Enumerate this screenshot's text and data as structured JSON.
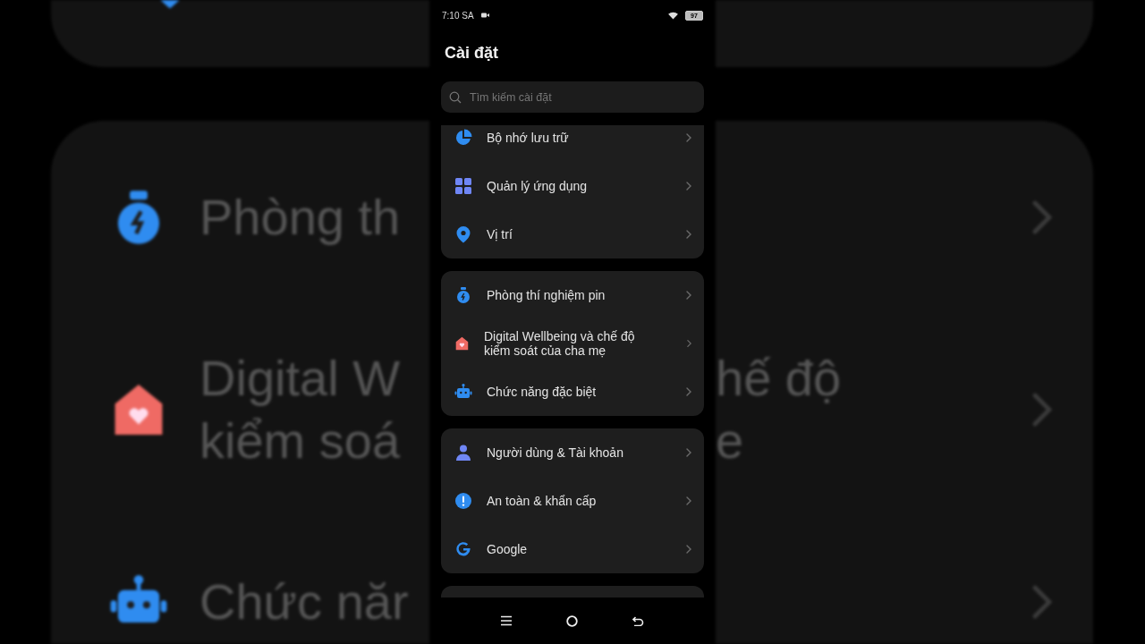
{
  "status_bar": {
    "time": "7:10 SA",
    "battery": "97"
  },
  "title": "Cài đặt",
  "search": {
    "placeholder": "Tìm kiếm cài đặt"
  },
  "groups": [
    {
      "items": [
        {
          "kind": "storage",
          "label": "Bộ nhớ lưu trữ"
        },
        {
          "kind": "apps",
          "label": "Quản lý ứng dụng"
        },
        {
          "kind": "location",
          "label": "Vị trí"
        }
      ]
    },
    {
      "items": [
        {
          "kind": "battery",
          "label": "Phòng thí nghiệm pin"
        },
        {
          "kind": "wellbeing",
          "label": "Digital Wellbeing và chế độ kiểm soát của cha mẹ"
        },
        {
          "kind": "accessibility",
          "label": "Chức năng đặc biệt"
        }
      ]
    },
    {
      "items": [
        {
          "kind": "user",
          "label": "Người dùng & Tài khoản"
        },
        {
          "kind": "safety",
          "label": "An toàn & khẩn cấp"
        },
        {
          "kind": "google",
          "label": "Google"
        }
      ]
    },
    {
      "clipped": true
    }
  ],
  "backdrop": {
    "rows": [
      {
        "kind": "battery",
        "left_lines": [
          "Phòng th"
        ],
        "right_lines": []
      },
      {
        "kind": "wellbeing",
        "left_lines": [
          "Digital W",
          "kiểm soá"
        ],
        "right_lines": [
          "hế độ",
          "e"
        ]
      },
      {
        "kind": "accessibility",
        "left_lines": [
          "Chức năr"
        ],
        "right_lines": []
      }
    ]
  }
}
